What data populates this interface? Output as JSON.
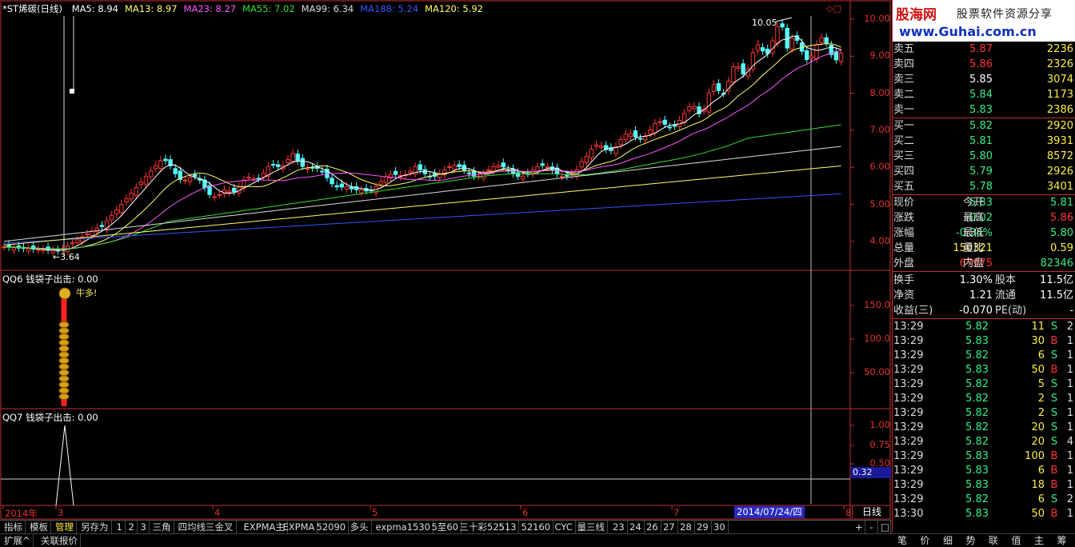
{
  "stock": {
    "name": "*ST烯碳(日线)"
  },
  "ma_legend": [
    {
      "label": "MA5: 8.94",
      "color": "#ffffff"
    },
    {
      "label": "MA13: 8.97",
      "color": "#ffff66"
    },
    {
      "label": "MA23: 8.27",
      "color": "#ff55ff"
    },
    {
      "label": "MA55: 7.02",
      "color": "#33dd33"
    },
    {
      "label": "MA99: 6.34",
      "color": "#dddddd"
    },
    {
      "label": "MA188: 5.24",
      "color": "#3355ff"
    },
    {
      "label": "MA120: 5.92",
      "color": "#ffff66"
    }
  ],
  "price_axis": [
    "10.00",
    "9.00",
    "8.00",
    "7.00",
    "6.00",
    "5.00",
    "4.00"
  ],
  "annotations": {
    "high": "10.05",
    "low": "3.64"
  },
  "panel2": {
    "title": "QQ6 钱袋子出击: 0.00",
    "icon_text": "牛多!",
    "axis": [
      "150.0",
      "100.0",
      "50.00"
    ]
  },
  "panel3": {
    "title": "QQ7 钱袋子出击: 0.00",
    "axis": [
      "1.00",
      "0.75",
      "0.50"
    ],
    "cursor_value": "0.32"
  },
  "date_axis": {
    "labels": [
      "2014年",
      "3",
      "4",
      "5",
      "6",
      "7",
      "8"
    ],
    "cursor_date": "2014/07/24/四",
    "period": "日线"
  },
  "toolbar": [
    "指标",
    "模板",
    "管理",
    "另存为",
    "1",
    "2",
    "3",
    "三角",
    "四均线三金叉",
    "EXPMA主",
    "EXPMA",
    "52090",
    "多头",
    "expma1530",
    "5至60",
    "三十彩525",
    "513",
    "52160",
    "CYC",
    "量三线",
    "23",
    "24",
    "26",
    "27",
    "28",
    "29",
    "30"
  ],
  "toolbar_right": [
    "+",
    "-",
    "□"
  ],
  "bottom_tabs": [
    "扩展^",
    "关联报价"
  ],
  "right_tabs": [
    "笔",
    "价",
    "细",
    "势",
    "联",
    "值",
    "主",
    "筹"
  ],
  "banner": {
    "logo": "股海网",
    "slogan": "股票软件资源分享",
    "url": "www.Guhai.com.cn"
  },
  "order_book": {
    "sell": [
      {
        "label": "卖五",
        "price": "5.87",
        "vol": "2236"
      },
      {
        "label": "卖四",
        "price": "5.86",
        "vol": "2326"
      },
      {
        "label": "卖三",
        "price": "5.85",
        "vol": "3074"
      },
      {
        "label": "卖二",
        "price": "5.84",
        "vol": "1173"
      },
      {
        "label": "卖一",
        "price": "5.83",
        "vol": "2386"
      }
    ],
    "buy": [
      {
        "label": "买一",
        "price": "5.82",
        "vol": "2920"
      },
      {
        "label": "买二",
        "price": "5.81",
        "vol": "3931"
      },
      {
        "label": "买三",
        "price": "5.80",
        "vol": "8572"
      },
      {
        "label": "买四",
        "price": "5.79",
        "vol": "2926"
      },
      {
        "label": "买五",
        "price": "5.78",
        "vol": "3401"
      }
    ]
  },
  "quote": [
    {
      "l1": "现价",
      "v1": "5.83",
      "l2": "今开",
      "v2": "5.81"
    },
    {
      "l1": "涨跌",
      "v1": "-0.02",
      "l2": "最高",
      "v2": "5.86"
    },
    {
      "l1": "涨幅",
      "v1": "-0.34%",
      "l2": "最低",
      "v2": "5.80"
    },
    {
      "l1": "总量",
      "v1": "150321",
      "l2": "量比",
      "v2": "0.59"
    },
    {
      "l1": "外盘",
      "v1": "67975",
      "l2": "内盘",
      "v2": "82346"
    }
  ],
  "stats": [
    {
      "l1": "换手",
      "v1": "1.30%",
      "l2": "股本",
      "v2": "11.5亿"
    },
    {
      "l1": "净资",
      "v1": "1.21",
      "l2": "流通",
      "v2": "11.5亿"
    },
    {
      "l1": "收益(三)",
      "v1": "-0.070",
      "l2": "PE(动)",
      "v2": "-"
    }
  ],
  "ticks": [
    {
      "time": "13:29",
      "price": "5.82",
      "vol": "11",
      "side": "S",
      "n": "2"
    },
    {
      "time": "13:29",
      "price": "5.83",
      "vol": "30",
      "side": "B",
      "n": "1"
    },
    {
      "time": "13:29",
      "price": "5.82",
      "vol": "6",
      "side": "S",
      "n": "1"
    },
    {
      "time": "13:29",
      "price": "5.83",
      "vol": "50",
      "side": "B",
      "n": "1"
    },
    {
      "time": "13:29",
      "price": "5.82",
      "vol": "5",
      "side": "S",
      "n": "1"
    },
    {
      "time": "13:29",
      "price": "5.82",
      "vol": "2",
      "side": "S",
      "n": "1"
    },
    {
      "time": "13:29",
      "price": "5.82",
      "vol": "2",
      "side": "S",
      "n": "1"
    },
    {
      "time": "13:29",
      "price": "5.82",
      "vol": "20",
      "side": "S",
      "n": "1"
    },
    {
      "time": "13:29",
      "price": "5.82",
      "vol": "20",
      "side": "S",
      "n": "4"
    },
    {
      "time": "13:29",
      "price": "5.83",
      "vol": "100",
      "side": "B",
      "n": "1"
    },
    {
      "time": "13:29",
      "price": "5.83",
      "vol": "6",
      "side": "B",
      "n": "1"
    },
    {
      "time": "13:29",
      "price": "5.83",
      "vol": "18",
      "side": "B",
      "n": "1"
    },
    {
      "time": "13:29",
      "price": "5.82",
      "vol": "6",
      "side": "S",
      "n": "2"
    },
    {
      "time": "13:30",
      "price": "5.83",
      "vol": "50",
      "side": "B",
      "n": "1"
    }
  ],
  "colors": {
    "up": "#ff3333",
    "down": "#33ee88",
    "flat": "#ffffff",
    "axis": "#c03030",
    "candle_down": "#54fcfc"
  }
}
